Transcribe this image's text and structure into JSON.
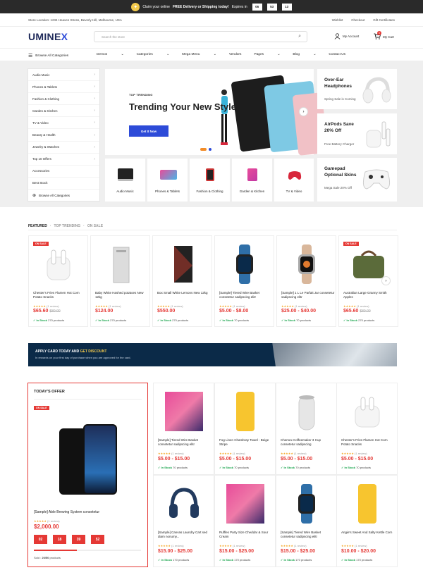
{
  "promo_bar": {
    "text_pre": "Claim your online ",
    "text_bold": "FREE Delivery or Shipping today!",
    "text_post": " Expires in",
    "countdown": [
      "06",
      "53",
      "13"
    ]
  },
  "utility": {
    "location": "Store Location: 1234 Heaven Stress, Beverly Hill, Melbourne, USA",
    "links": [
      "Wishlist",
      "Checkout",
      "Gift Certificates"
    ]
  },
  "header": {
    "logo_main": "UMINE",
    "logo_accent": "X",
    "search_placeholder": "Search the store",
    "account": "My Account",
    "cart": "My Cart",
    "cart_count": "0"
  },
  "nav": {
    "browse": "Browse All Categories",
    "items": [
      "Demos",
      "Categories",
      "Mega Menu",
      "Vendors",
      "Pages",
      "Blog",
      "Contact Us"
    ]
  },
  "sidebar": {
    "items": [
      "Audio Music",
      "Phones & Tablets",
      "Fashion & Clothing",
      "Garden & Kitchen",
      "TV & Video",
      "Beauty & Health",
      "Jewelry & Watches",
      "Top 10 Offers",
      "Accessories",
      "Best Stock"
    ],
    "browse": "Browse All Categories"
  },
  "slider": {
    "tag": "TOP TRENDING",
    "title": "Trending Your New Style",
    "button": "Get It Now"
  },
  "promos": [
    {
      "title": "Over-Ear Headphones",
      "sub": "Spring Sale is Coming"
    },
    {
      "title": "AirPods Save 20% Off",
      "sub": "Free Battery Charger"
    },
    {
      "title": "Gamepad Optional Skins",
      "sub": "Mega Sale 20% Off"
    }
  ],
  "categories": [
    "Audio Music",
    "Phones & Tablets",
    "Fashion & Clothing",
    "Garden & Kitchen",
    "TV & Video"
  ],
  "tabs": [
    "FEATURED",
    "TOP TRENDING",
    "ON SALE"
  ],
  "sale_badge": "ON SALE",
  "reviews_label": "(1 review)",
  "in_stock": "In Stock",
  "featured": [
    {
      "name": "Chester's Fries Flamen Hot Corn Potato Snacks",
      "price": "$65.60",
      "old": "$80.00",
      "qty": "270 products"
    },
    {
      "name": "Baby White Hashed potatoes New 12kg",
      "price": "$124.00",
      "old": "",
      "qty": "270 products"
    },
    {
      "name": "Box Small White Lemons New 12kg",
      "price": "$550.00",
      "old": "",
      "qty": "270 products"
    },
    {
      "name": "[Sample] Tiered Wire Basket consetetur sadipscing elitr",
      "price": "$5.00 - $8.00",
      "old": "",
      "qty": "70 products"
    },
    {
      "name": "[Sample] 1 L Le Parfait Jar consetetur sadipscing elitr",
      "price": "$25.00 - $40.00",
      "old": "",
      "qty": "70 products"
    },
    {
      "name": "Australian Large Granny Smith Apples",
      "price": "$65.60",
      "old": "$80.00",
      "qty": "270 products"
    }
  ],
  "card_banner": {
    "title_pre": "APPLY CARD TODAY AND ",
    "title_hl": "GET DISCOUNT",
    "sub": "In rewards on your first day of purchase when you are approved for the card."
  },
  "offer": {
    "heading": "TODAY'S OFFER",
    "name": "[Sample] Able Brewing System consetetur",
    "price": "$2,000.00",
    "countdown": [
      "02",
      "18",
      "39",
      "52"
    ],
    "progress": 0.4,
    "sold_label": "Sold :",
    "sold_value": "20/50",
    "sold_unit": "products"
  },
  "grid": [
    {
      "name": "[Sample] Tiered Wire Basket consetetur sadipscing elitr",
      "price": "$5.00 - $15.00",
      "qty": "70 products"
    },
    {
      "name": "Fog Linen Chambray Towel - Beige Stripe",
      "price": "$5.00 - $15.00",
      "qty": "70 products"
    },
    {
      "name": "Chemex Coffeemaker 3 Cup consetetur sadipscing",
      "price": "$5.00 - $15.00",
      "qty": "70 products"
    },
    {
      "name": "Chester's Fries Flamen Hot Corn Potato Snacks",
      "price": "$5.00 - $15.00",
      "qty": "70 products"
    },
    {
      "name": "[Sample] Canvas Laundry Cart sed diam nonumy...",
      "price": "$15.00 - $25.00",
      "qty": "170 products"
    },
    {
      "name": "Ruffles Party Size Cheddar & Sour Cream",
      "price": "$15.00 - $25.00",
      "qty": "170 products"
    },
    {
      "name": "[Sample] Tiered Wire Basket consetetur sadipscing elitr",
      "price": "$15.00 - $25.00",
      "qty": "170 products"
    },
    {
      "name": "Angie's Sweet And Salty Kettle Corn",
      "price": "$10.00 - $20.00",
      "qty": "170 products"
    }
  ]
}
